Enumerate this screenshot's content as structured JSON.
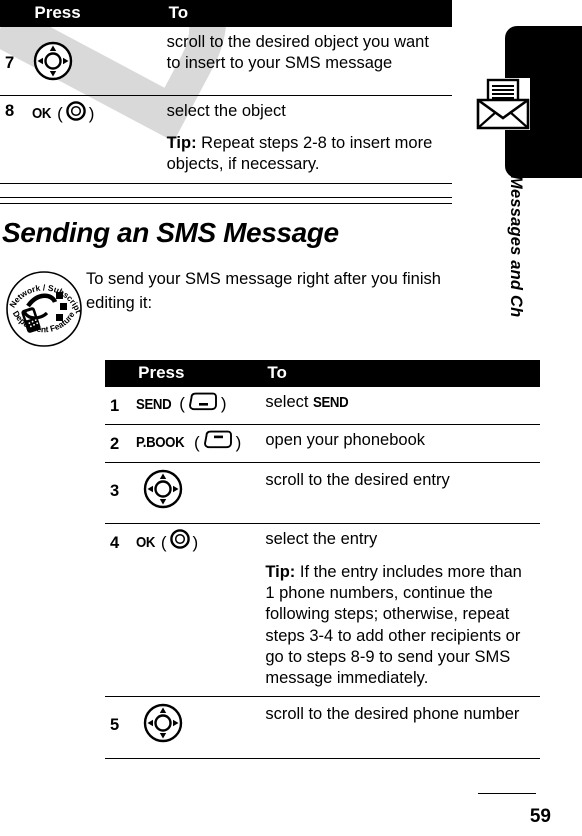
{
  "document": {
    "page_number": "59",
    "watermark": "DRAFT",
    "section_heading": "Sending an SMS Message",
    "intro_paragraph": "To send your SMS message right after you finish editing it:"
  },
  "sidebar": {
    "tab_label": "Messages and Ch",
    "icon": "envelope-message-icon",
    "badge_icon": "network-subscription-dependent-feature-icon",
    "badge_text_top": "Network / Subscription",
    "badge_text_bottom": "Dependent  Feature"
  },
  "table_insert_object": {
    "headers": {
      "press": "Press",
      "to": "To"
    },
    "rows": [
      {
        "num": "7",
        "key_label": "",
        "key_icon": "navigation-key-icon",
        "to": "scroll to the desired object you want to insert to your SMS message",
        "tip_prefix": "",
        "tip": ""
      },
      {
        "num": "8",
        "key_label": "OK",
        "key_icon": "center-select-key-icon",
        "to": "select the object",
        "tip_prefix": "Tip:",
        "tip": " Repeat steps 2-8 to insert more objects, if necessary."
      }
    ]
  },
  "table_sending_sms": {
    "headers": {
      "press": "Press",
      "to": "To"
    },
    "rows": [
      {
        "num": "1",
        "key_label": "SEND",
        "key_icon": "left-softkey-icon",
        "to_prefix": "select ",
        "to_em": "SEND",
        "to": "",
        "tip_prefix": "",
        "tip": ""
      },
      {
        "num": "2",
        "key_label": "P.BOOK",
        "key_icon": "right-softkey-icon",
        "to_prefix": "",
        "to_em": "",
        "to": "open your phonebook",
        "tip_prefix": "",
        "tip": ""
      },
      {
        "num": "3",
        "key_label": "",
        "key_icon": "navigation-key-icon",
        "to_prefix": "",
        "to_em": "",
        "to": "scroll to the desired entry",
        "tip_prefix": "",
        "tip": ""
      },
      {
        "num": "4",
        "key_label": "OK",
        "key_icon": "center-select-key-icon",
        "to_prefix": "",
        "to_em": "",
        "to": "select the entry",
        "tip_prefix": "Tip:",
        "tip": " If the entry includes more than 1 phone numbers, continue the following steps; otherwise, repeat steps 3-4 to add other recipients or go to steps 8-9 to send your SMS message immediately."
      },
      {
        "num": "5",
        "key_label": "",
        "key_icon": "navigation-key-icon",
        "to_prefix": "",
        "to_em": "",
        "to": "scroll to the desired phone number",
        "tip_prefix": "",
        "tip": ""
      }
    ]
  }
}
